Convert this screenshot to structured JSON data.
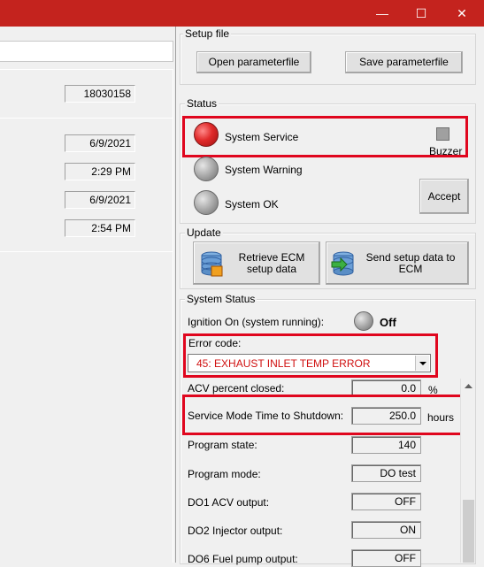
{
  "window": {
    "controls": [
      "—",
      "☐",
      "✕"
    ]
  },
  "left": {
    "serial_value": "18030158",
    "date1": "6/9/2021",
    "time1": "2:29 PM",
    "date2": "6/9/2021",
    "time2": "2:54 PM"
  },
  "setup_file": {
    "legend": "Setup file",
    "open_label": "Open parameterfile",
    "save_label": "Save parameterfile"
  },
  "status": {
    "legend": "Status",
    "service_label": "System Service",
    "warning_label": "System Warning",
    "ok_label": "System OK",
    "buzzer_label": "Buzzer",
    "accept_label": "Accept"
  },
  "update": {
    "legend": "Update",
    "retrieve_label": "Retrieve ECM setup data",
    "send_label": "Send setup data to ECM"
  },
  "system_status": {
    "legend": "System Status",
    "ignition_label": "Ignition On (system running):",
    "ignition_value": "Off",
    "error_label": "Error code:",
    "error_value": "45: EXHAUST INLET TEMP ERROR",
    "acv_label": "ACV percent closed:",
    "acv_value": "0.0",
    "acv_unit": "%",
    "service_mode_label": "Service Mode Time to Shutdown:",
    "service_mode_value": "250.0",
    "service_mode_unit": "hours",
    "program_state_label": "Program state:",
    "program_state_value": "140",
    "program_mode_label": "Program mode:",
    "program_mode_value": "DO test",
    "do1_label": "DO1 ACV output:",
    "do1_value": "OFF",
    "do2_label": "DO2 Injector output:",
    "do2_value": "ON",
    "do6_label": "DO6 Fuel pump output:",
    "do6_value": "OFF"
  },
  "colors": {
    "titlebar": "#c4231e",
    "highlight": "#e0061e",
    "error_text": "#d01010"
  }
}
